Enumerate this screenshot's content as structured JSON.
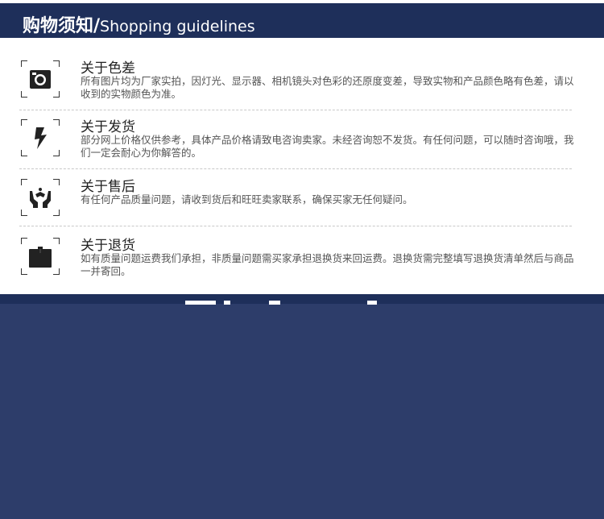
{
  "header": {
    "title_zh": "购物须知/",
    "title_en": "Shopping guidelines"
  },
  "sections": [
    {
      "icon": "camera-icon",
      "title": "关于色差",
      "body": "所有图片均为厂家实拍，因灯光、显示器、相机镜头对色彩的还原度变差，导致实物和产品颜色略有色差，请以收到的实物颜色为准。"
    },
    {
      "icon": "lightning-icon",
      "title": "关于发货",
      "body": "部分网上价格仅供参考，具体产品价格请致电咨询卖家。未经咨询恕不发货。有任何问题，可以随时咨询哦，我们一定会耐心为你解答的。"
    },
    {
      "icon": "hands-icon",
      "title": "关于售后",
      "body": "有任何产品质量问题，请收到货后和旺旺卖家联系，确保买家无任何疑问。"
    },
    {
      "icon": "box-icon",
      "title": "关于退货",
      "body": "如有质量问题运费我们承担，非质量问题需买家承担退换货来回运费。退换货需完整填写退换货清单然后与商品一并寄回。"
    }
  ],
  "colors": {
    "header_bg": "#1e2f5a",
    "bottom_bg": "#2d3d6a"
  }
}
